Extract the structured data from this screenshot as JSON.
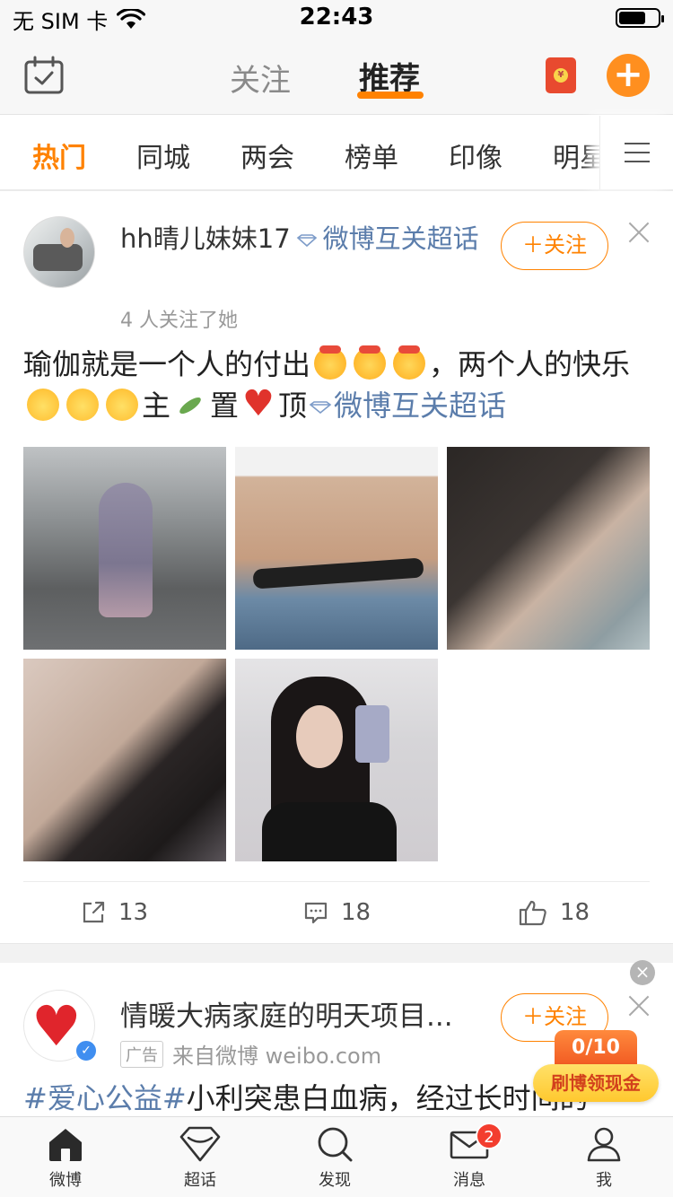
{
  "status_bar": {
    "carrier": "无 SIM 卡",
    "time": "22:43"
  },
  "top_nav": {
    "tab_follow": "关注",
    "tab_recommend": "推荐",
    "active_tab": "推荐",
    "red_packet_glyph": "¥",
    "plus_glyph": "+",
    "accent_color": "#ff8200"
  },
  "channels": {
    "items": [
      "热门",
      "同城",
      "两会",
      "榜单",
      "印像",
      "明星"
    ],
    "active": "热门"
  },
  "post": {
    "user_name": "hh晴儿妹妹17",
    "topic_tag": "微博互关超话",
    "follower_info": "4 人关注了她",
    "follow_label": "＋关注",
    "text_part1": "瑜伽就是一个人的付出",
    "text_part2": "，两个人的快乐",
    "text_part3": "主",
    "text_part4": "置",
    "text_part5": "顶",
    "text_tag": "微博互关超话",
    "image_count": 5,
    "actions": {
      "share_count": "13",
      "comment_count": "18",
      "like_count": "18"
    }
  },
  "ad_post": {
    "title": "情暖大病家庭的明天项目...",
    "ad_label": "广告",
    "source": "来自微博 weibo.com",
    "follow_label": "＋关注",
    "text_tag": "#爱心公益#",
    "text_body": "小利突患白血病，经过长时间的"
  },
  "reward_widget": {
    "close_glyph": "×",
    "counter": "0/10",
    "button_label": "刷博领现金"
  },
  "tabbar": {
    "items": [
      {
        "label": "微博",
        "icon": "home-icon"
      },
      {
        "label": "超话",
        "icon": "diamond-icon"
      },
      {
        "label": "发现",
        "icon": "search-icon"
      },
      {
        "label": "消息",
        "icon": "mail-icon",
        "badge": "2"
      },
      {
        "label": "我",
        "icon": "person-icon"
      }
    ]
  }
}
